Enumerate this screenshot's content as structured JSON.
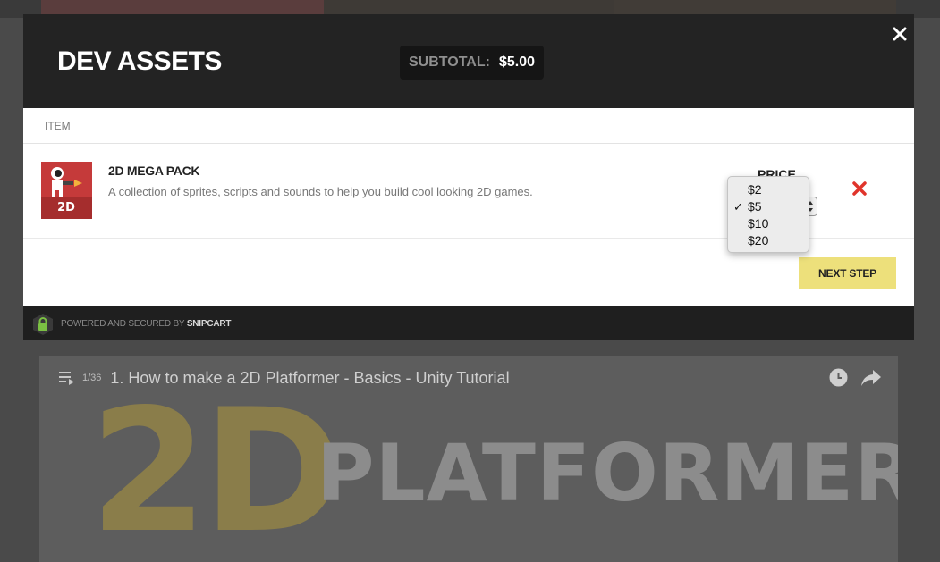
{
  "modal": {
    "title": "DEV ASSETS",
    "subtotal_label": "SUBTOTAL:",
    "subtotal_value": "$5.00",
    "close_icon": "close-icon"
  },
  "cart": {
    "column_item": "ITEM",
    "items": [
      {
        "name": "2D MEGA PACK",
        "description": "A collection of sprites, scripts and sounds to help you build cool looking 2D games.",
        "thumbnail_text": "2D",
        "price_label": "PRICE",
        "remove_icon": "remove-icon"
      }
    ],
    "next_step_label": "NEXT STEP"
  },
  "price_dropdown": {
    "selected": "$5",
    "options": [
      "$2",
      "$5",
      "$10",
      "$20"
    ],
    "check_mark": "✓"
  },
  "footer": {
    "text": "POWERED AND SECURED BY ",
    "brand": "SNIPCART",
    "lock_icon": "lock-icon"
  },
  "background_video": {
    "playlist_count": "1/36",
    "title": "1. How to make a 2D Platformer - Basics - Unity Tutorial",
    "art_text_1": "2D",
    "art_text_2": "PLATFORMER",
    "icons": [
      "playlist-icon",
      "clock-icon",
      "share-icon"
    ]
  },
  "colors": {
    "header_bg": "#232323",
    "button_accent": "#ede07b",
    "remove_red": "#e0342b",
    "lock_green": "#7bc043"
  }
}
